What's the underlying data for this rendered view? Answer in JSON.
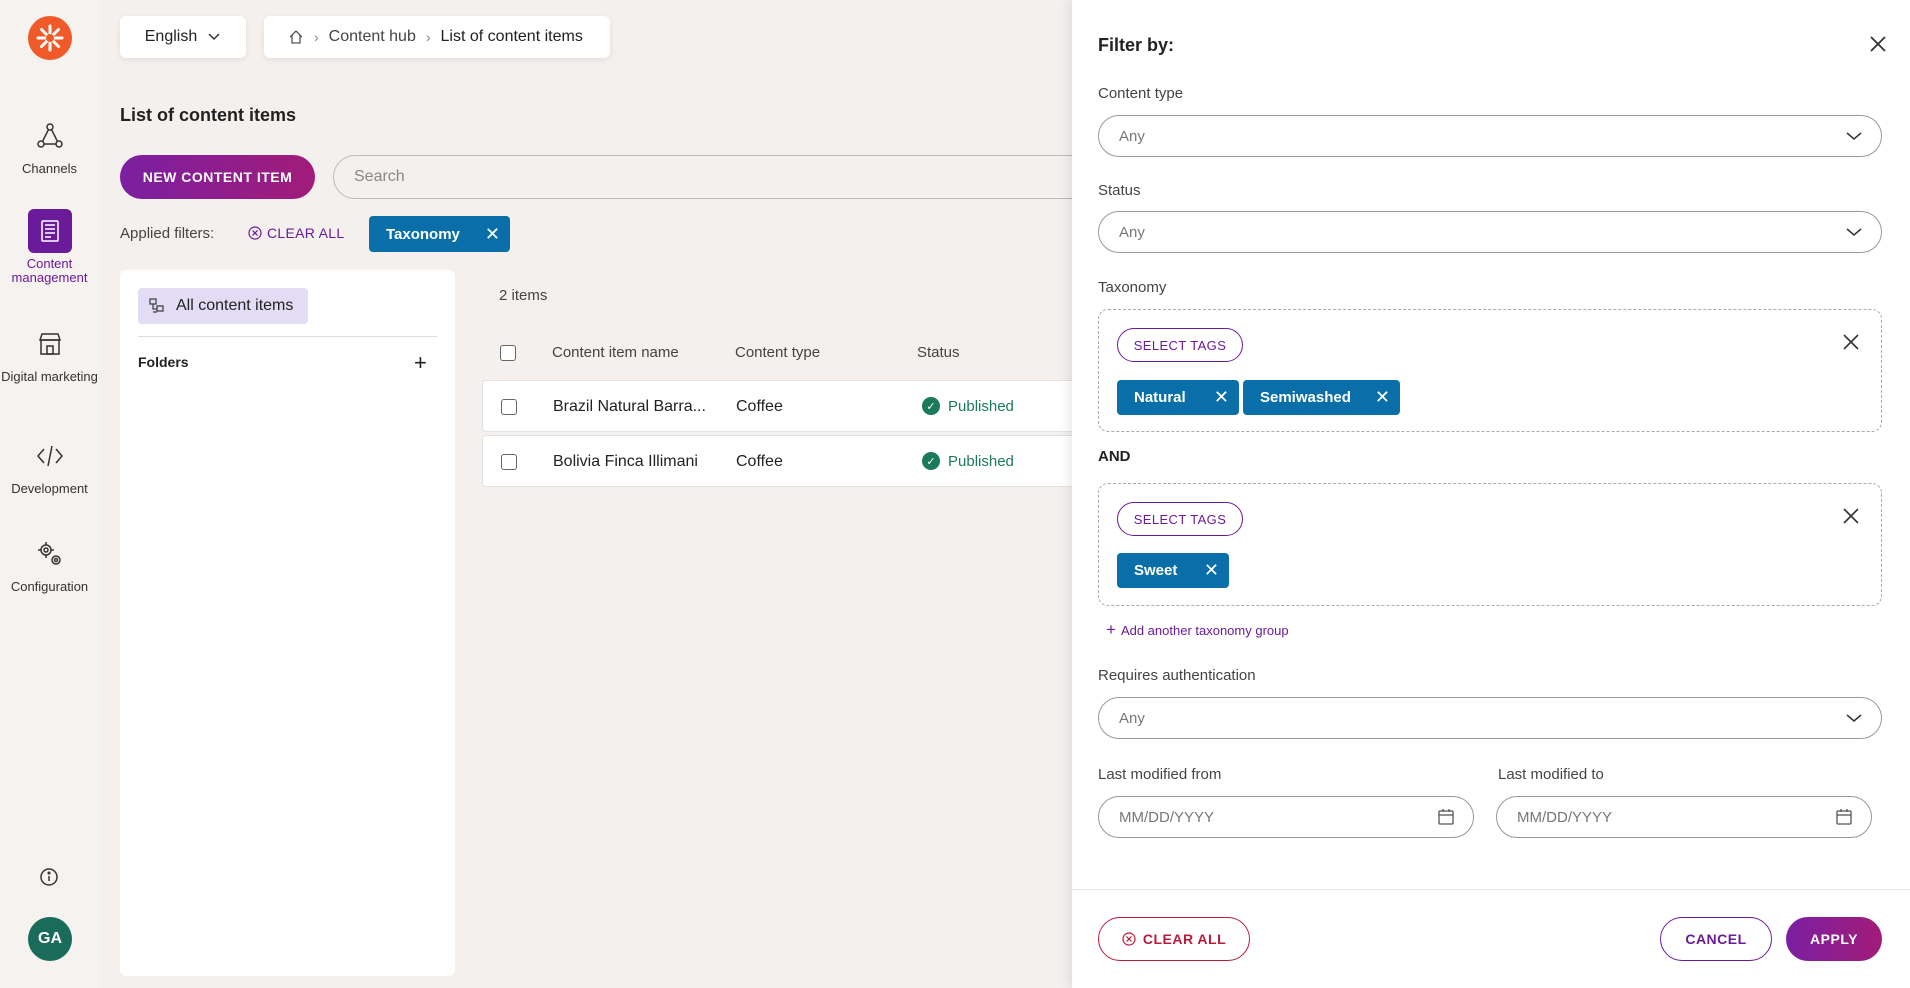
{
  "nav": {
    "items": [
      {
        "label": "Channels"
      },
      {
        "label": "Content management"
      },
      {
        "label": "Digital marketing"
      },
      {
        "label": "Development"
      },
      {
        "label": "Configuration"
      }
    ],
    "avatar_initials": "GA"
  },
  "topbar": {
    "language": "English",
    "breadcrumb": [
      "Content hub",
      "List of content items"
    ]
  },
  "main": {
    "title": "List of content items",
    "new_button": "NEW CONTENT ITEM",
    "search_placeholder": "Search",
    "applied_filters_label": "Applied filters:",
    "clear_all": "CLEAR ALL",
    "applied_chips": [
      "Taxonomy"
    ]
  },
  "folders": {
    "all_items": "All content items",
    "folders_label": "Folders"
  },
  "list": {
    "count": "2 items",
    "columns": [
      "Content item name",
      "Content type",
      "Status"
    ],
    "rows": [
      {
        "name": "Brazil Natural Barra...",
        "type": "Coffee",
        "status": "Published"
      },
      {
        "name": "Bolivia Finca Illimani",
        "type": "Coffee",
        "status": "Published"
      }
    ]
  },
  "filter_panel": {
    "title": "Filter by:",
    "content_type_label": "Content type",
    "content_type_value": "Any",
    "status_label": "Status",
    "status_value": "Any",
    "taxonomy_label": "Taxonomy",
    "select_tags": "SELECT TAGS",
    "groups": [
      {
        "tags": [
          "Natural",
          "Semiwashed"
        ]
      },
      {
        "tags": [
          "Sweet"
        ]
      }
    ],
    "and_label": "AND",
    "add_group": "Add another taxonomy group",
    "auth_label": "Requires authentication",
    "auth_value": "Any",
    "modified_from_label": "Last modified from",
    "modified_to_label": "Last modified to",
    "date_placeholder": "MM/DD/YYYY",
    "clear_all": "CLEAR ALL",
    "cancel": "CANCEL",
    "apply": "APPLY"
  },
  "colors": {
    "brand_purple": "#6a1b9a",
    "chip_blue": "#0a6fa8",
    "published_green": "#1b7a5a",
    "danger_red": "#b71c3c",
    "logo_orange": "#f05a28"
  }
}
